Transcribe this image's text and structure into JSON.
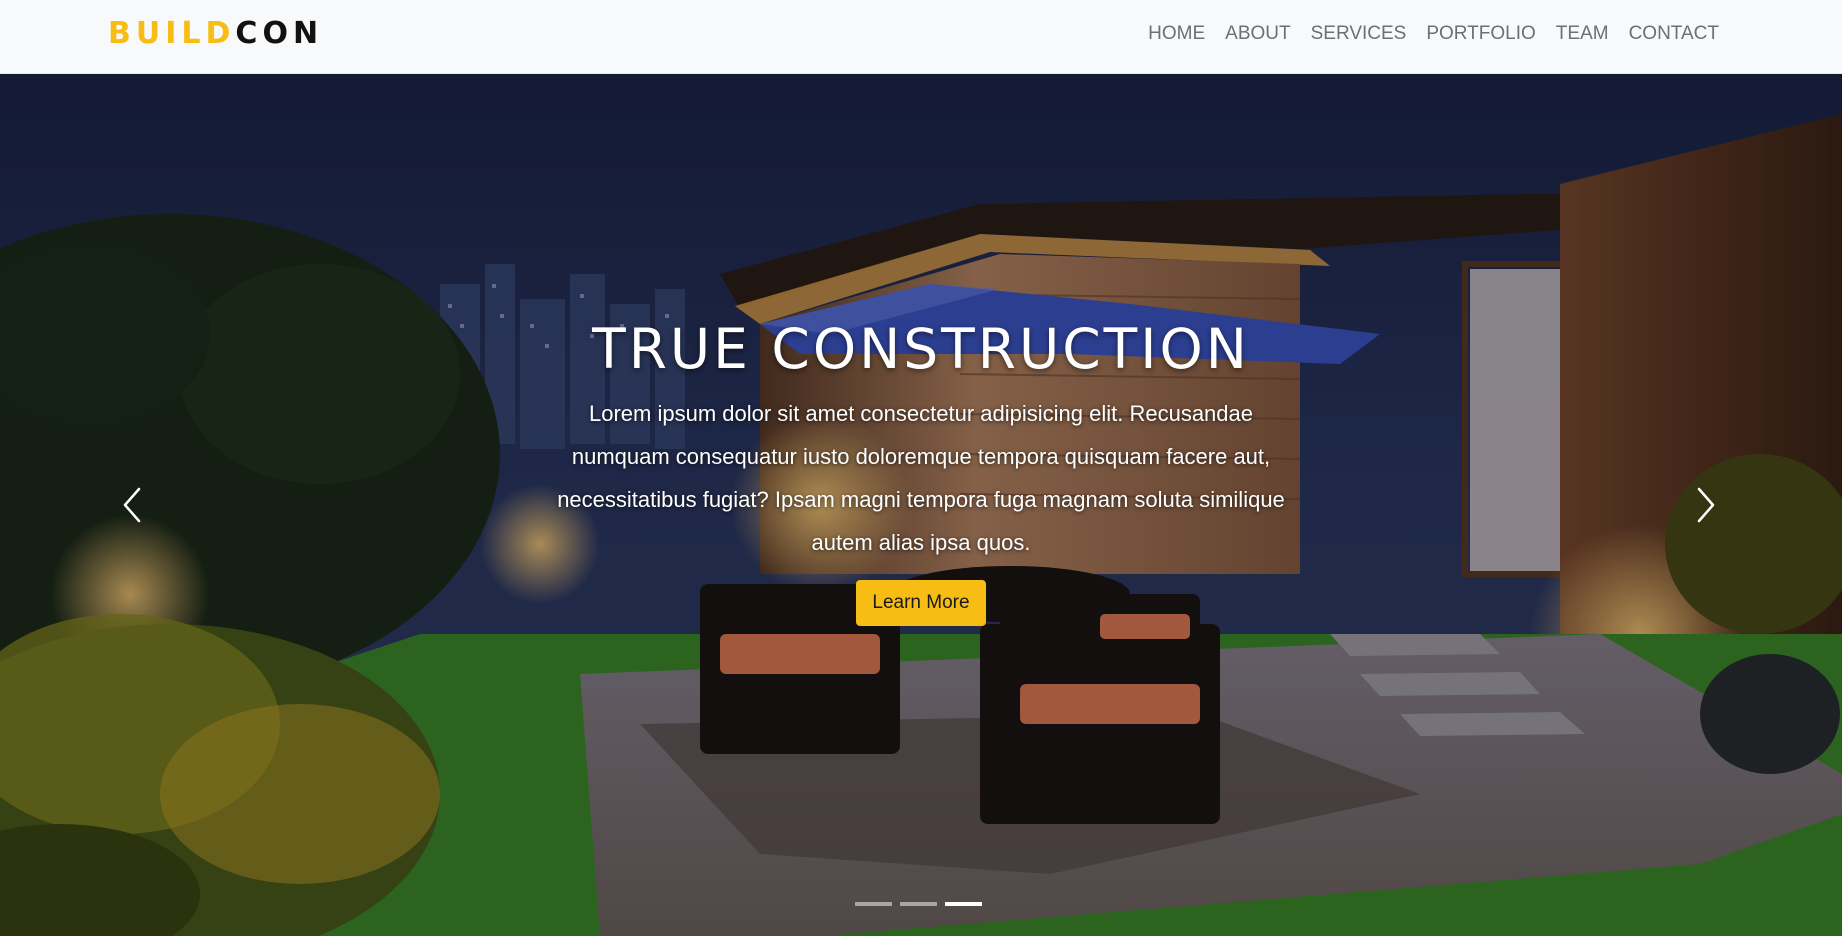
{
  "brand": {
    "part1": "BUILD",
    "part2": "CON",
    "accent_color": "#f7bd14"
  },
  "nav": {
    "items": [
      {
        "label": "HOME"
      },
      {
        "label": "ABOUT"
      },
      {
        "label": "SERVICES"
      },
      {
        "label": "PORTFOLIO"
      },
      {
        "label": "TEAM"
      },
      {
        "label": "CONTACT"
      }
    ]
  },
  "hero": {
    "title": "TRUE CONSTRUCTION",
    "text": "Lorem ipsum dolor sit amet consectetur adipisicing elit. Recusandae numquam consequatur iusto doloremque tempora quisquam facere aut, necessitatibus fugiat? Ipsam magni tempora fuga magnam soluta similique autem alias ipsa quos.",
    "button_label": "Learn More",
    "button_color": "#f7bd14",
    "prev_icon": "chevron-left-icon",
    "next_icon": "chevron-right-icon",
    "slides_total": 3,
    "active_slide": 3
  }
}
